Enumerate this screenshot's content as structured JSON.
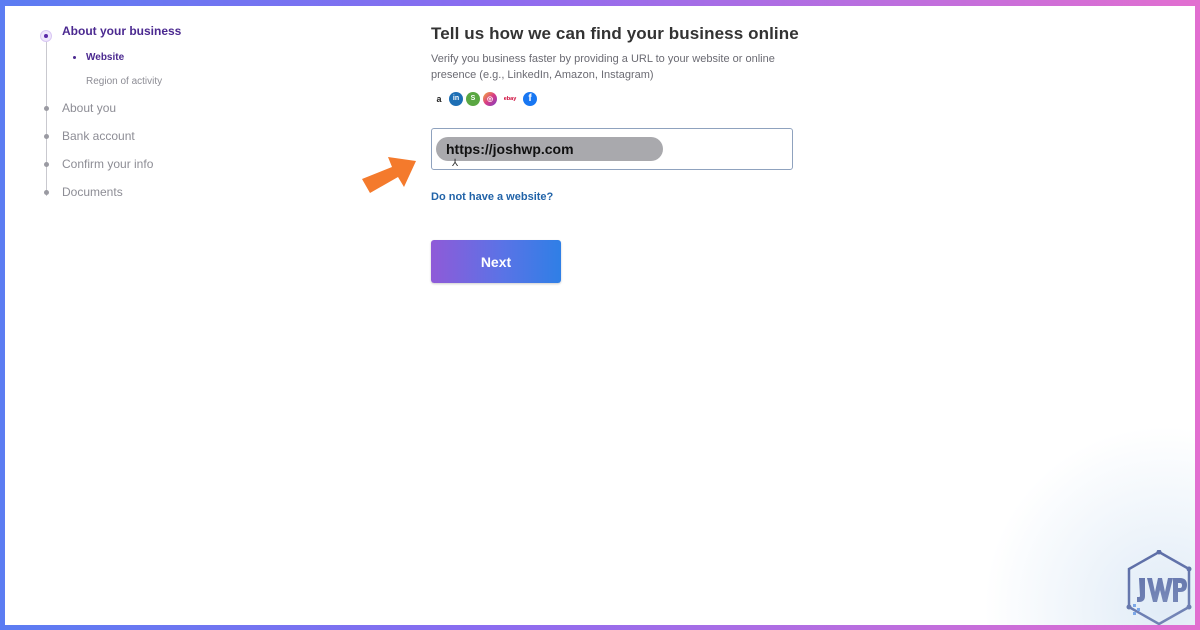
{
  "stepper": {
    "steps": [
      {
        "label": "About your business",
        "active": true
      },
      {
        "label": "About you"
      },
      {
        "label": "Bank account"
      },
      {
        "label": "Confirm your info"
      },
      {
        "label": "Documents"
      }
    ],
    "substeps": [
      {
        "label": "Website",
        "active": true
      },
      {
        "label": "Region of activity"
      }
    ]
  },
  "form": {
    "heading": "Tell us how we can find your business online",
    "description": "Verify you business faster by providing a URL to your website or online presence (e.g., LinkedIn, Amazon, Instagram)",
    "icons": [
      "amazon-icon",
      "linkedin-icon",
      "shopify-icon",
      "instagram-icon",
      "ebay-icon",
      "facebook-icon"
    ],
    "icon_glyphs": {
      "amazon": "a",
      "linkedin": "in",
      "shop": "S",
      "insta": "◎",
      "ebay": "ebay",
      "fb": "f"
    },
    "url_value": "https://joshwp.com",
    "no_website_link": "Do not have a website?",
    "next_button": "Next"
  },
  "colors": {
    "accent": "#4b2990",
    "link": "#2163a8",
    "arrow": "#f47a2c",
    "button_gradient": [
      "#8f5ad8",
      "#2f7fe6"
    ]
  }
}
